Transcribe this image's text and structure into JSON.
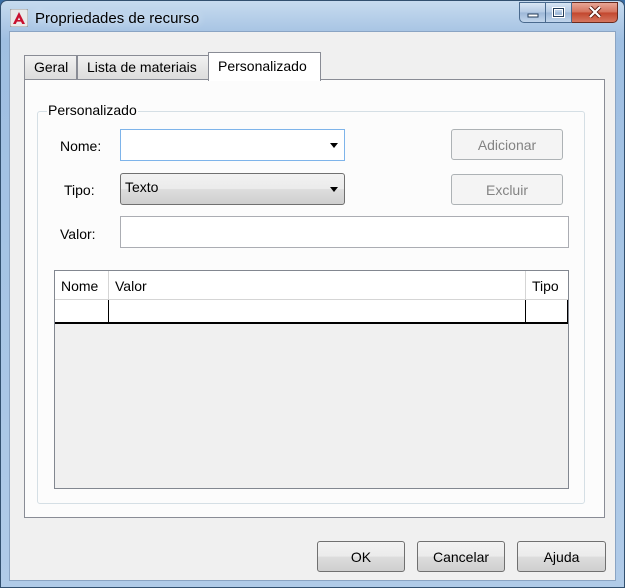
{
  "window": {
    "title": "Propriedades de recurso",
    "icon": "autocad-logo-icon",
    "controls": [
      "minimize-icon",
      "maximize-icon",
      "close-icon"
    ]
  },
  "tabs": [
    {
      "label": "Geral",
      "active": false
    },
    {
      "label": "Lista de materiais",
      "active": false
    },
    {
      "label": "Personalizado",
      "active": true
    }
  ],
  "group": {
    "legend": "Personalizado",
    "name_label": "Nome:",
    "name_value": "",
    "type_label": "Tipo:",
    "type_value": "Texto",
    "value_label": "Valor:",
    "value_value": "",
    "add_label": "Adicionar",
    "delete_label": "Excluir"
  },
  "grid": {
    "columns": [
      "Nome",
      "Valor",
      "Tipo"
    ],
    "rows": [
      [
        "",
        "",
        ""
      ]
    ]
  },
  "footer": {
    "ok_label": "OK",
    "cancel_label": "Cancelar",
    "help_label": "Ajuda"
  },
  "colors": {
    "accent_red": "#c8102e",
    "focus_border": "#7eb4ea",
    "close_button": "#c2462d"
  }
}
